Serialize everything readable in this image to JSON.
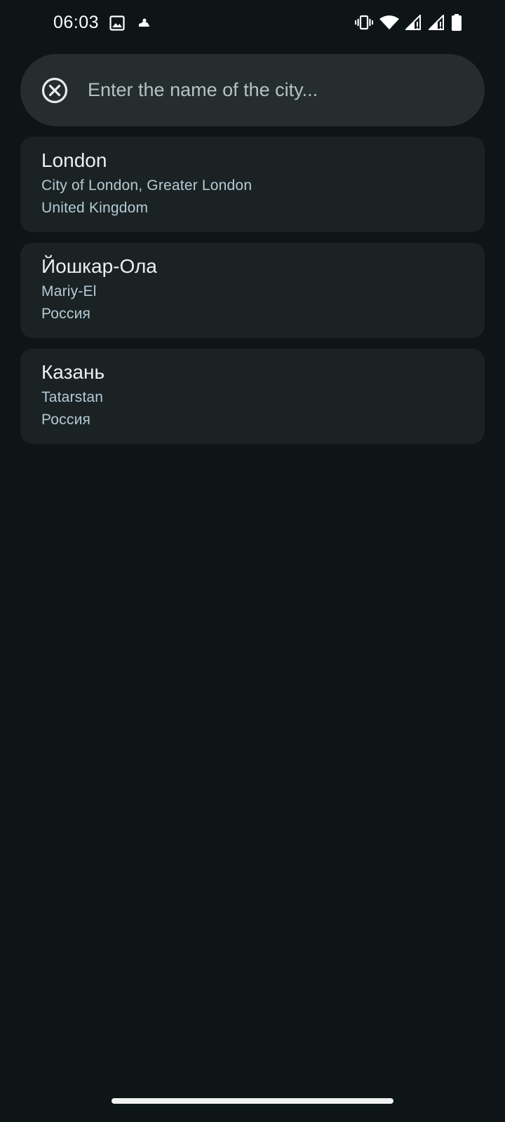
{
  "status_bar": {
    "time": "06:03",
    "left_icons": [
      "gallery-icon",
      "weather-cloud-icon"
    ],
    "right_icons": [
      "vibrate-icon",
      "wifi-icon",
      "signal-icon",
      "signal-icon",
      "battery-icon"
    ]
  },
  "search": {
    "placeholder": "Enter the name of the city...",
    "value": "",
    "clear_icon": "close-circle-icon"
  },
  "results": [
    {
      "name": "London",
      "region": "City of London, Greater London",
      "country": "United Kingdom"
    },
    {
      "name": "Йошкар-Ола",
      "region": "Mariy-El",
      "country": "Россия"
    },
    {
      "name": "Казань",
      "region": "Tatarstan",
      "country": "Россия"
    }
  ],
  "colors": {
    "background": "#0d1517",
    "search_bg": "#252d2f",
    "card_bg": "#1a2224",
    "secondary_text": "#b4cad4"
  }
}
